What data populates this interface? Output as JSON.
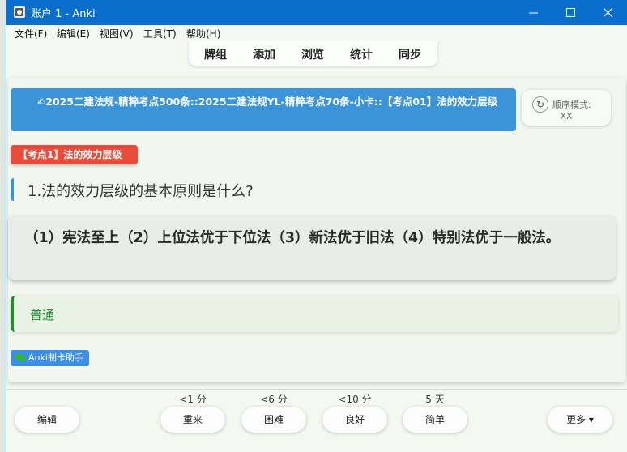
{
  "window": {
    "title": "账户 1 - Anki",
    "controls": [
      "minimize",
      "maximize",
      "close"
    ]
  },
  "menu": [
    "文件(F)",
    "编辑(E)",
    "视图(V)",
    "工具(T)",
    "帮助(H)"
  ],
  "top_tabs": [
    "牌组",
    "添加",
    "浏览",
    "统计",
    "同步"
  ],
  "deck_path": "✍2025二建法规-精粹考点500条::2025二建法规YL-精粹考点70条-小卡::【考点01】法的效力层级",
  "order_mode": {
    "label": "顺序模式:",
    "value": "XX"
  },
  "tag": "【考点1】法的效力层级",
  "question": "1.法的效力层级的基本原则是什么?",
  "answer": "（1）宪法至上（2）上位法优于下位法（3）新法优于旧法（4）特别法优于一般法。",
  "level": "普通",
  "badge": "Anki制卡助手",
  "bottom": {
    "edit": "编辑",
    "more": "更多 ▾",
    "buttons": [
      {
        "label": "重来",
        "interval": "<1 分"
      },
      {
        "label": "困难",
        "interval": "<6 分"
      },
      {
        "label": "良好",
        "interval": "<10 分"
      },
      {
        "label": "简单",
        "interval": "5 天"
      }
    ]
  },
  "colors": {
    "accent": "#3c94d8",
    "tag": "#e74c3c",
    "level": "#1f8f2a",
    "titlebar": "#0a6fcc"
  }
}
